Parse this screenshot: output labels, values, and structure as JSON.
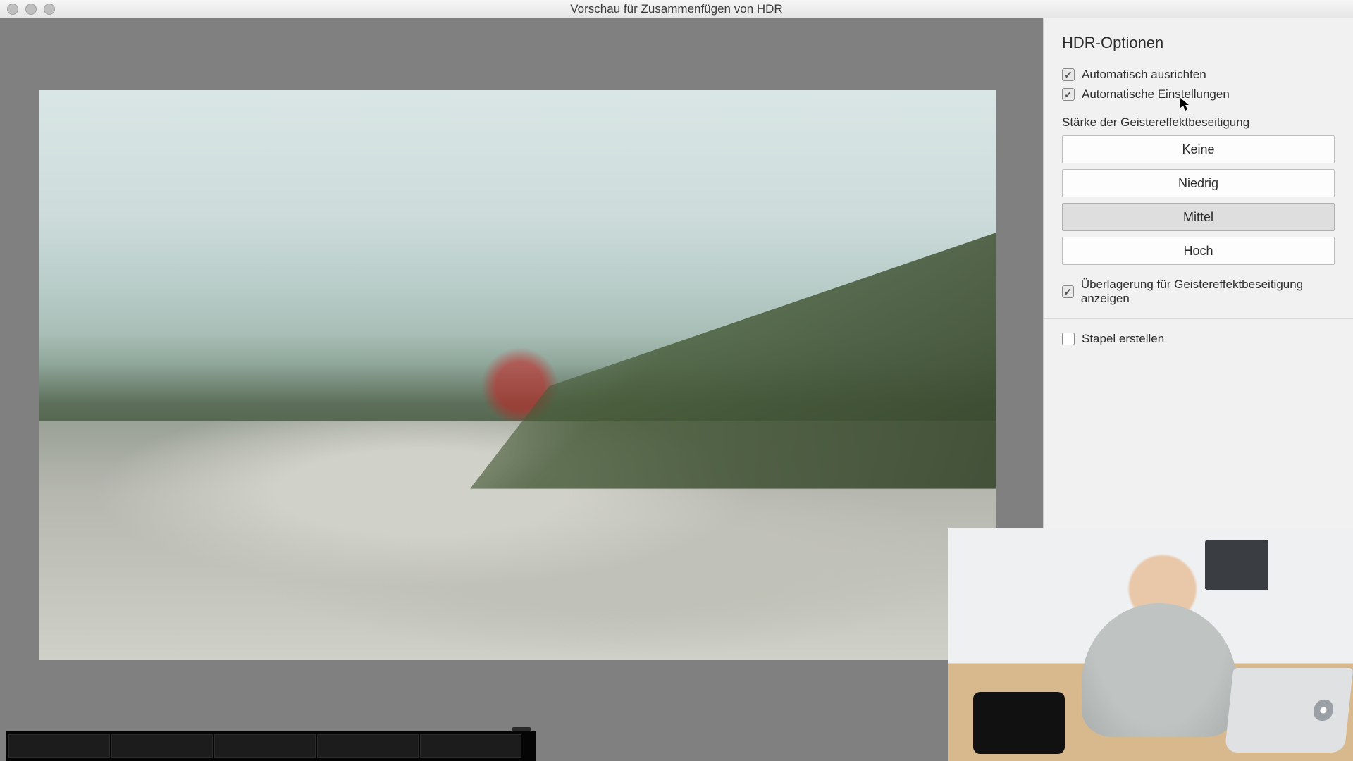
{
  "window": {
    "title": "Vorschau für Zusammenfügen von HDR"
  },
  "panel": {
    "heading": "HDR-Optionen",
    "auto_align": {
      "label": "Automatisch ausrichten",
      "checked": true
    },
    "auto_settings": {
      "label": "Automatische Einstellungen",
      "checked": true
    },
    "deghost_label": "Stärke der Geistereffektbeseitigung",
    "deghost_options": {
      "none": "Keine",
      "low": "Niedrig",
      "mid": "Mittel",
      "high": "Hoch",
      "selected": "mid"
    },
    "show_overlay": {
      "label": "Überlagerung für Geistereffektbeseitigung anzeigen",
      "checked": true
    },
    "create_stack": {
      "label": "Stapel erstellen",
      "checked": false
    }
  }
}
